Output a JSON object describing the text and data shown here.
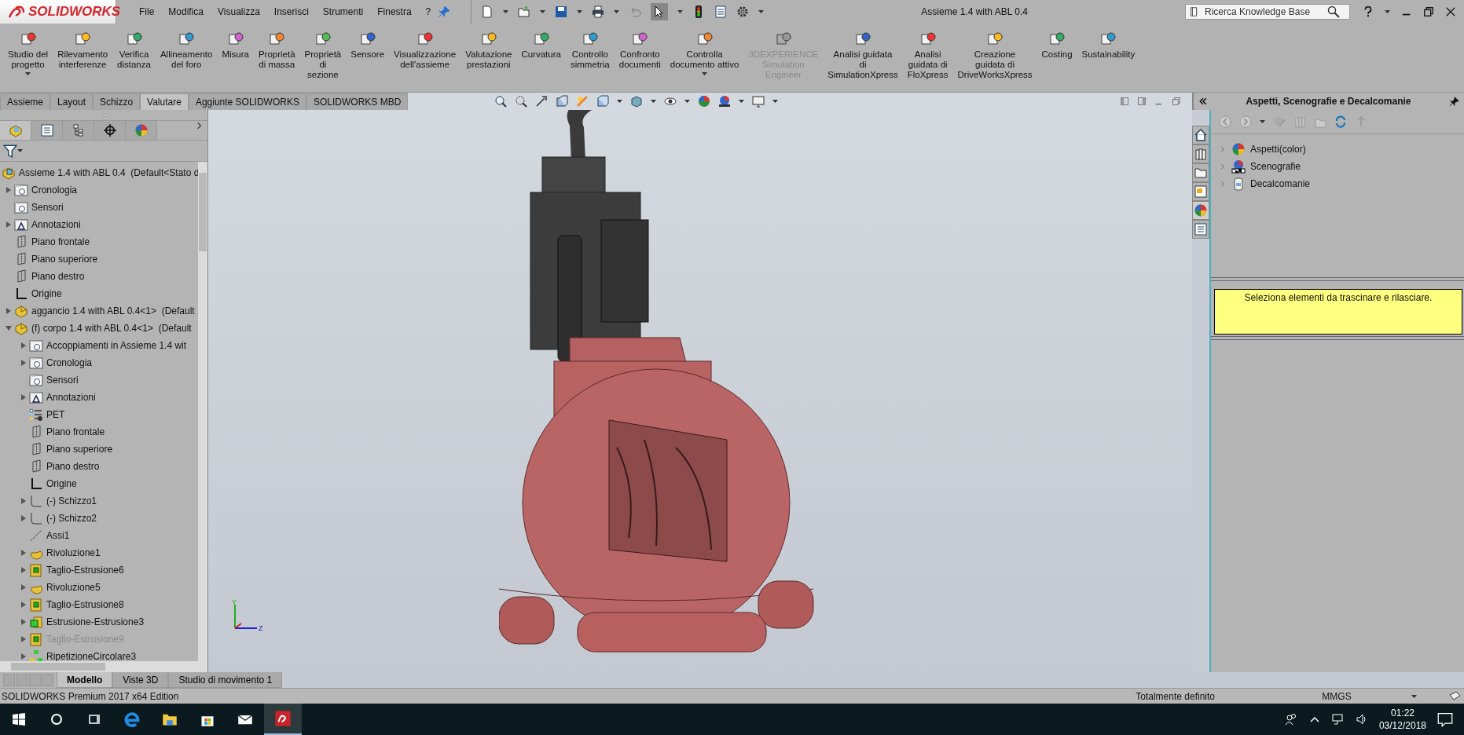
{
  "app": {
    "logo": "SOLIDWORKS",
    "menu": [
      "File",
      "Modifica",
      "Visualizza",
      "Inserisci",
      "Strumenti",
      "Finestra",
      "?"
    ],
    "document_title": "Assieme 1.4 with ABL 0.4",
    "search": {
      "placeholder": "Ricerca Knowledge Base"
    }
  },
  "ribbon": [
    {
      "label": "Studio del\nprogetto",
      "dropdown": true,
      "disabled": false
    },
    {
      "label": "Rilevamento\ninterferenze",
      "dropdown": false,
      "disabled": false
    },
    {
      "label": "Verifica\ndistanza",
      "dropdown": false,
      "disabled": false
    },
    {
      "label": "Allineamento\ndel foro",
      "dropdown": false,
      "disabled": false
    },
    {
      "label": "Misura",
      "dropdown": false,
      "disabled": false
    },
    {
      "label": "Proprietà\ndi massa",
      "dropdown": false,
      "disabled": false
    },
    {
      "label": "Proprietà\ndi\nsezione",
      "dropdown": false,
      "disabled": false
    },
    {
      "label": "Sensore",
      "dropdown": false,
      "disabled": false
    },
    {
      "label": "Visualizzazione\ndell'assieme",
      "dropdown": false,
      "disabled": false
    },
    {
      "label": "Valutazione\nprestazioni",
      "dropdown": false,
      "disabled": false
    },
    {
      "label": "Curvatura",
      "dropdown": false,
      "disabled": false
    },
    {
      "label": "Controllo\nsimmetria",
      "dropdown": false,
      "disabled": false
    },
    {
      "label": "Confronto\ndocumenti",
      "dropdown": false,
      "disabled": false
    },
    {
      "label": "Controlla\ndocumento attivo",
      "dropdown": true,
      "disabled": false
    },
    {
      "label": "3DEXPERIENCE\nSimulation\nEngineer",
      "dropdown": false,
      "disabled": true
    },
    {
      "label": "Analisi guidata\ndi\nSimulationXpress",
      "dropdown": false,
      "disabled": false
    },
    {
      "label": "Analisi\nguidata di\nFloXpress",
      "dropdown": false,
      "disabled": false
    },
    {
      "label": "Creazione\nguidata di\nDriveWorksXpress",
      "dropdown": false,
      "disabled": false
    },
    {
      "label": "Costing",
      "dropdown": false,
      "disabled": false
    },
    {
      "label": "Sustainability",
      "dropdown": false,
      "disabled": false
    }
  ],
  "command_tabs": [
    {
      "label": "Assieme",
      "selected": false
    },
    {
      "label": "Layout",
      "selected": false
    },
    {
      "label": "Schizzo",
      "selected": false
    },
    {
      "label": "Valutare",
      "selected": true
    },
    {
      "label": "Aggiunte SOLIDWORKS",
      "selected": false
    },
    {
      "label": "SOLIDWORKS MBD",
      "selected": false
    }
  ],
  "panel_tabs": [
    {
      "kind": "assembly",
      "selected": true
    },
    {
      "kind": "list",
      "selected": false
    },
    {
      "kind": "tree",
      "selected": false
    },
    {
      "kind": "crosshair",
      "selected": false
    },
    {
      "kind": "ball",
      "selected": false
    }
  ],
  "tree": {
    "root": {
      "label": "Assieme 1.4 with ABL 0.4  (Default<Stato d",
      "kind": "assembly"
    },
    "items": [
      {
        "label": "Cronologia",
        "kind": "history",
        "expanded": false,
        "disabled": false
      },
      {
        "label": "Sensori",
        "kind": "sensor",
        "disabled": false
      },
      {
        "label": "Annotazioni",
        "kind": "annotation",
        "expanded": false,
        "disabled": false
      },
      {
        "label": "Piano frontale",
        "kind": "plane",
        "disabled": false
      },
      {
        "label": "Piano superiore",
        "kind": "plane",
        "disabled": false
      },
      {
        "label": "Piano destro",
        "kind": "plane",
        "disabled": false
      },
      {
        "label": "Origine",
        "kind": "origin",
        "disabled": false
      },
      {
        "label": "aggancio 1.4 with ABL 0.4<1>  (Default",
        "kind": "part",
        "expanded": false,
        "disabled": false
      },
      {
        "label": "(f) corpo 1.4 with ABL 0.4<1>  (Default",
        "kind": "part",
        "expanded": true,
        "disabled": false,
        "children": [
          {
            "label": "Accoppiamenti in Assieme 1.4 wit",
            "kind": "mates",
            "expanded": false,
            "disabled": false
          },
          {
            "label": "Cronologia",
            "kind": "history",
            "expanded": false,
            "disabled": false
          },
          {
            "label": "Sensori",
            "kind": "sensor",
            "disabled": false
          },
          {
            "label": "Annotazioni",
            "kind": "annotation",
            "expanded": false,
            "disabled": false
          },
          {
            "label": "PET",
            "kind": "pet",
            "disabled": false
          },
          {
            "label": "Piano frontale",
            "kind": "plane",
            "disabled": false
          },
          {
            "label": "Piano superiore",
            "kind": "plane",
            "disabled": false
          },
          {
            "label": "Piano destro",
            "kind": "plane",
            "disabled": false
          },
          {
            "label": "Origine",
            "kind": "origin",
            "disabled": false
          },
          {
            "label": "(-) Schizzo1",
            "kind": "sketch",
            "expanded": false,
            "disabled": false
          },
          {
            "label": "(-) Schizzo2",
            "kind": "sketch",
            "expanded": false,
            "disabled": false
          },
          {
            "label": "Assi1",
            "kind": "axis",
            "disabled": false
          },
          {
            "label": "Rivoluzione1",
            "kind": "revolve",
            "expanded": false,
            "disabled": false
          },
          {
            "label": "Taglio-Estrusione6",
            "kind": "cut",
            "expanded": false,
            "disabled": false
          },
          {
            "label": "Rivoluzione5",
            "kind": "revolve",
            "expanded": false,
            "disabled": false
          },
          {
            "label": "Taglio-Estrusione8",
            "kind": "cut",
            "expanded": false,
            "disabled": false
          },
          {
            "label": "Estrusione-Estrusione3",
            "kind": "extrude",
            "expanded": false,
            "disabled": false
          },
          {
            "label": "Taglio-Estrusione9",
            "kind": "cut",
            "expanded": false,
            "disabled": true
          },
          {
            "label": "RipetizioneCircolare3",
            "kind": "pattern",
            "expanded": false,
            "disabled": false
          }
        ]
      }
    ]
  },
  "triad": [
    "Y",
    "Z"
  ],
  "taskpane": {
    "title": "Aspetti, Scenografie e Decalcomanie",
    "tabs": [
      {
        "kind": "home",
        "selected": false
      },
      {
        "kind": "library",
        "selected": false
      },
      {
        "kind": "folder",
        "selected": false
      },
      {
        "kind": "layout",
        "selected": false
      },
      {
        "kind": "appearance",
        "selected": true
      },
      {
        "kind": "properties",
        "selected": false
      }
    ],
    "items": [
      {
        "label": "Aspetti(color)",
        "kind": "appearance"
      },
      {
        "label": "Scenografie",
        "kind": "scene"
      },
      {
        "label": "Decalcomanie",
        "kind": "decal"
      }
    ],
    "message": "Seleziona elementi da trascinare e rilasciare."
  },
  "bottom_tabs": [
    {
      "label": "Modello",
      "selected": true
    },
    {
      "label": "Viste 3D",
      "selected": false
    },
    {
      "label": "Studio di movimento 1",
      "selected": false
    }
  ],
  "status_bar": {
    "edition": "SOLIDWORKS Premium 2017 x64 Edition",
    "state": "Totalmente definito",
    "units": "MMGS"
  },
  "taskbar": {
    "time": "01:22",
    "date": "03/12/2018"
  }
}
